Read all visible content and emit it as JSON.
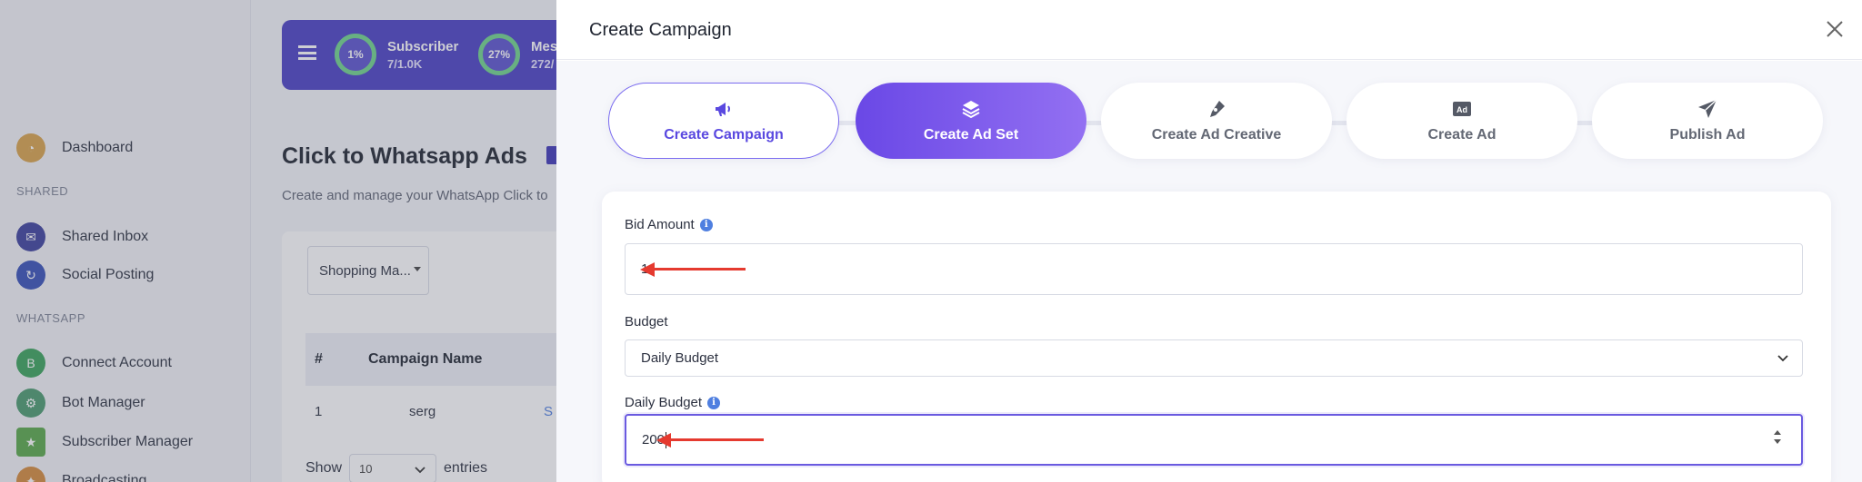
{
  "sidebar": {
    "dashboard": "Dashboard",
    "section_shared": "SHARED",
    "shared_inbox": "Shared Inbox",
    "social_posting": "Social Posting",
    "section_whatsapp": "WHATSAPP",
    "connect_account": "Connect Account",
    "bot_manager": "Bot Manager",
    "subscriber_manager": "Subscriber Manager",
    "broadcasting": "Broadcasting"
  },
  "stats": {
    "subscriber_pct": "1%",
    "subscriber_label": "Subscriber",
    "subscriber_count": "7/1.0K",
    "message_pct": "27%",
    "message_label": "Mes",
    "message_count": "272/"
  },
  "main": {
    "title": "Click to Whatsapp Ads",
    "subtitle": "Create and manage your WhatsApp Click to",
    "filter_value": "Shopping Ma...",
    "table_headers": [
      "#",
      "Campaign Name"
    ],
    "rows": [
      {
        "num": "1",
        "name": "serg",
        "extra": "S"
      }
    ],
    "show_label": "Show",
    "entries_value": "10",
    "entries_label": "entries"
  },
  "modal": {
    "title": "Create Campaign",
    "steps": [
      {
        "label": "Create Campaign",
        "icon": "megaphone-icon",
        "state": "done"
      },
      {
        "label": "Create Ad Set",
        "icon": "layers-icon",
        "state": "active"
      },
      {
        "label": "Create Ad Creative",
        "icon": "pen-icon",
        "state": "todo"
      },
      {
        "label": "Create Ad",
        "icon": "ad-icon",
        "state": "todo"
      },
      {
        "label": "Publish Ad",
        "icon": "send-icon",
        "state": "todo"
      }
    ],
    "form": {
      "bid_amount_label": "Bid Amount",
      "bid_amount_value": "1",
      "budget_label": "Budget",
      "budget_value": "Daily Budget",
      "daily_budget_label": "Daily Budget",
      "daily_budget_value": "200"
    },
    "info_glyph": "i"
  },
  "colors": {
    "accent": "#6a48e6",
    "annotation_arrow": "#e53a2f",
    "stats_bar": "#4a3fc4"
  }
}
